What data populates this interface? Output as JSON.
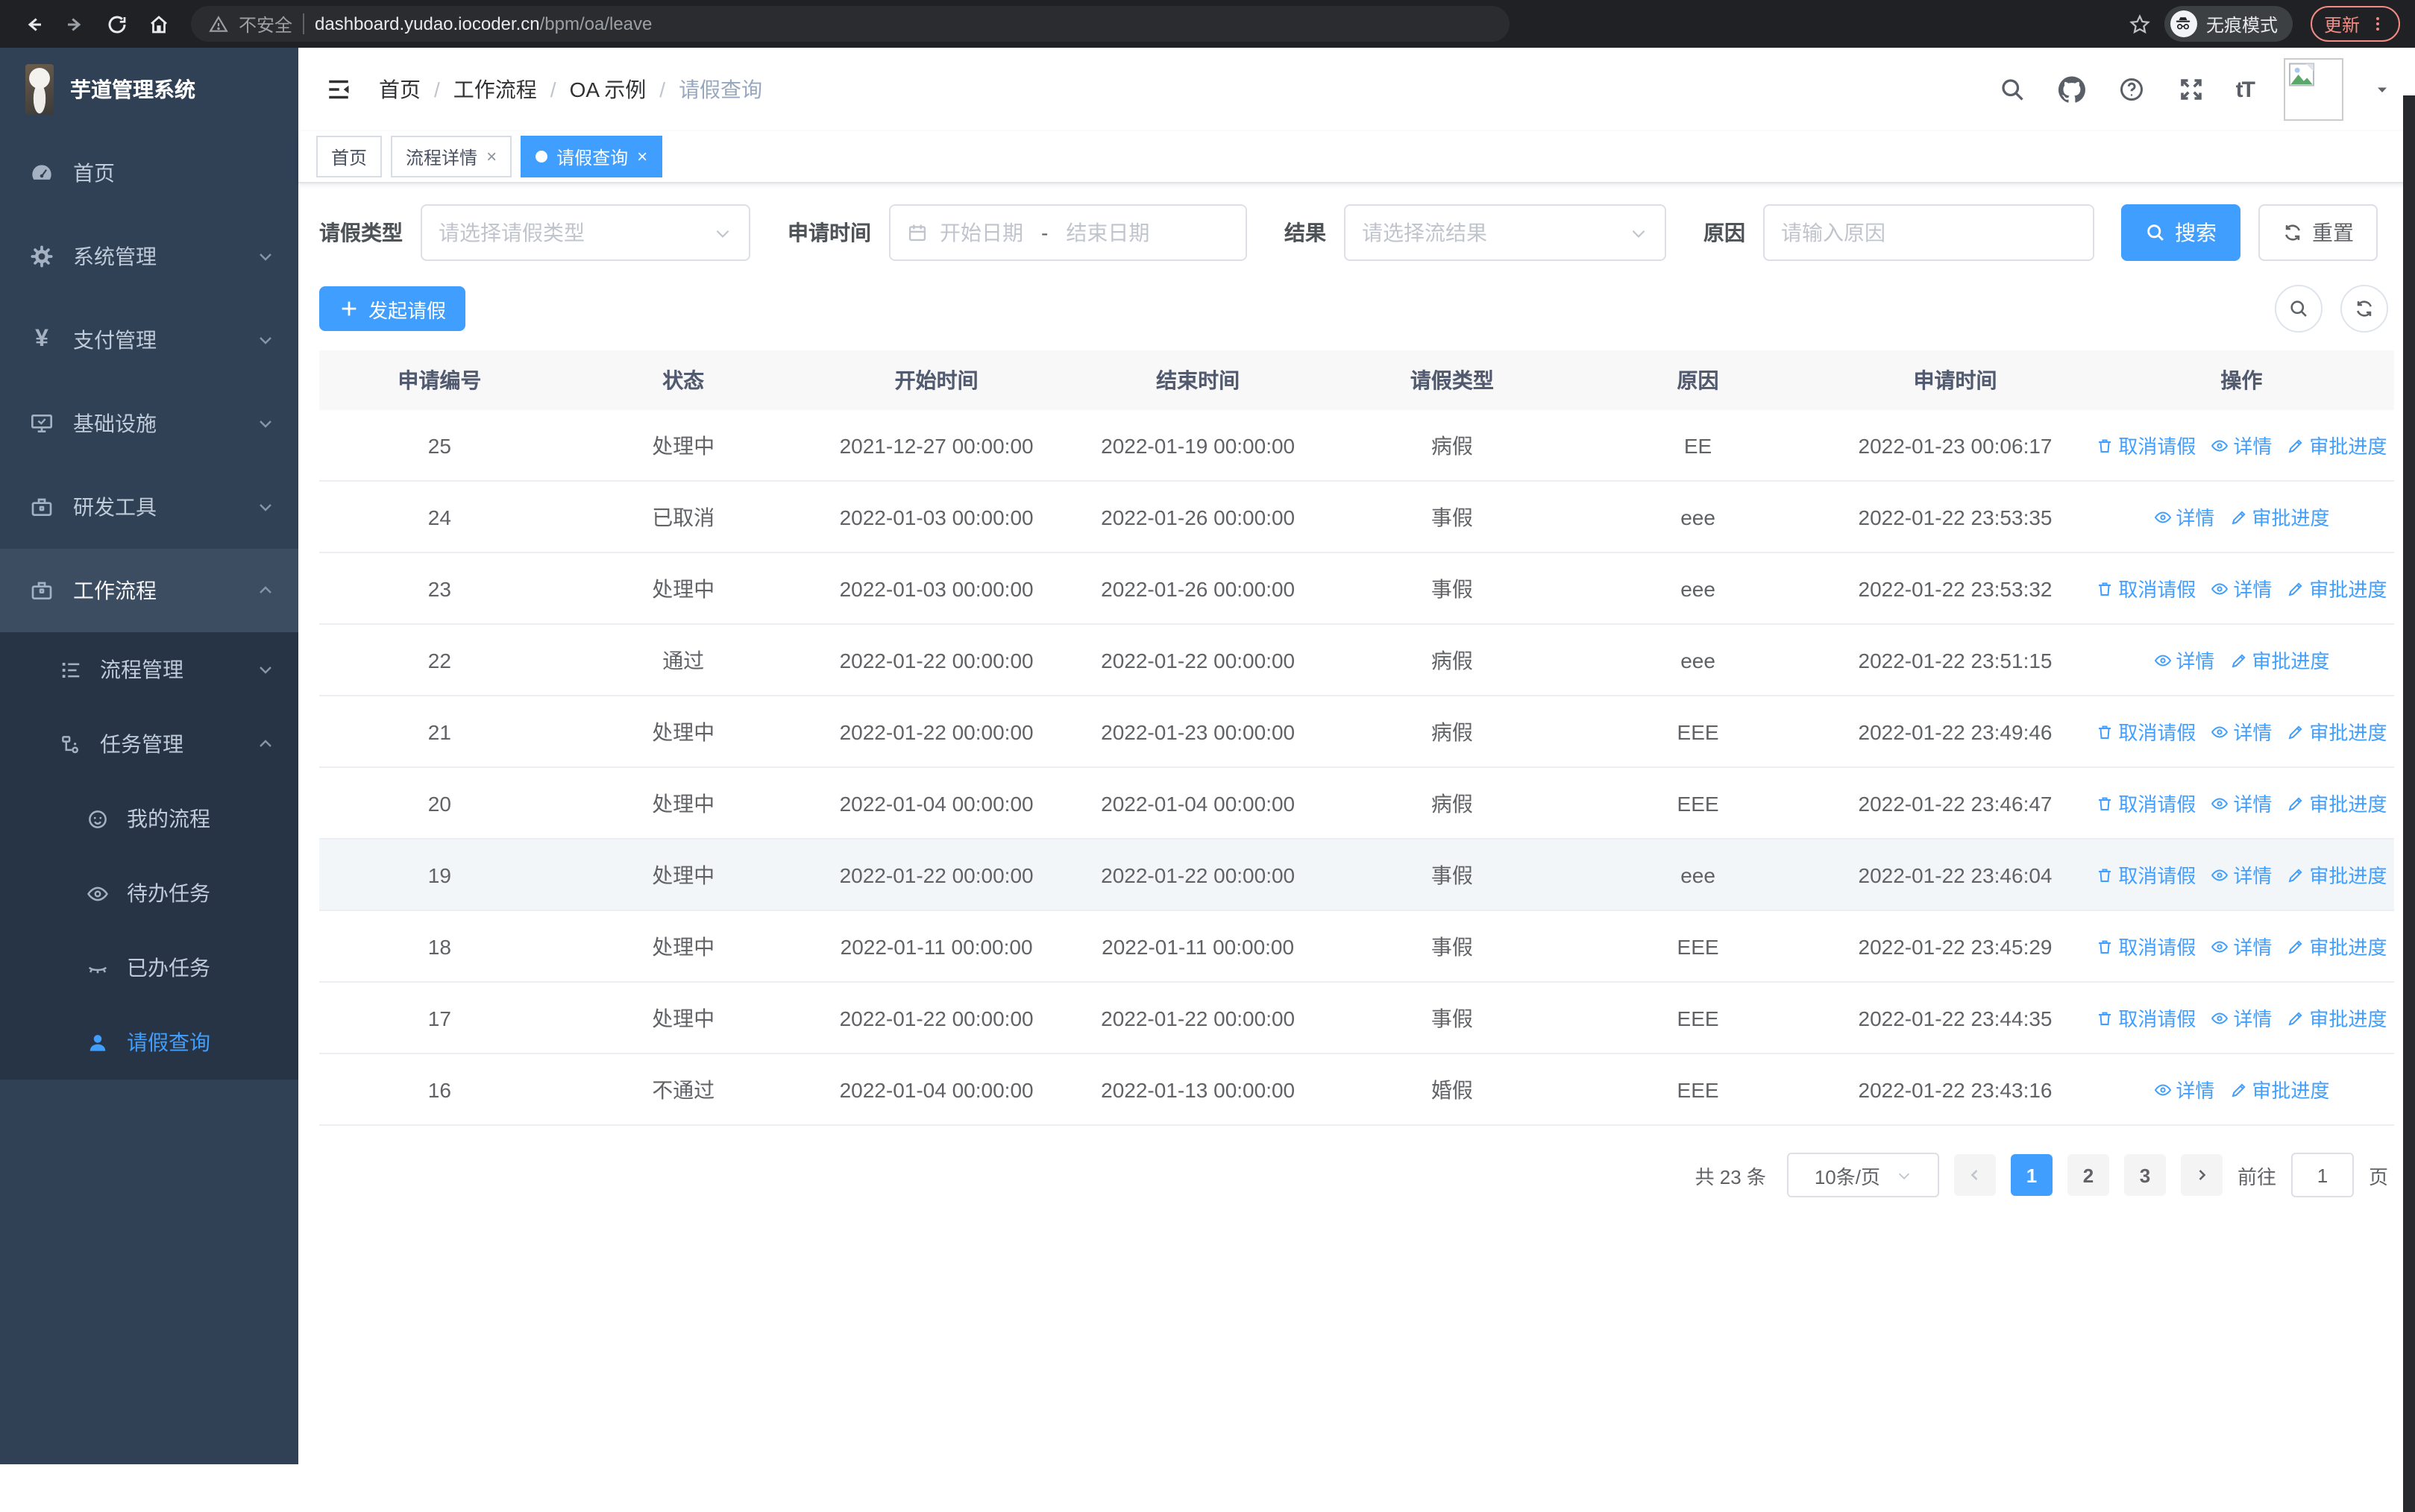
{
  "browser": {
    "security_label": "不安全",
    "url_host": "dashboard.yudao.iocoder.cn",
    "url_path": "/bpm/oa/leave",
    "incognito_label": "无痕模式",
    "update_label": "更新"
  },
  "sidebar": {
    "logo_title": "芋道管理系统",
    "items": [
      {
        "label": "首页"
      },
      {
        "label": "系统管理"
      },
      {
        "label": "支付管理"
      },
      {
        "label": "基础设施"
      },
      {
        "label": "研发工具"
      },
      {
        "label": "工作流程"
      }
    ],
    "submenu": [
      {
        "label": "流程管理"
      },
      {
        "label": "任务管理"
      }
    ],
    "task_children": [
      {
        "label": "我的流程"
      },
      {
        "label": "待办任务"
      },
      {
        "label": "已办任务"
      },
      {
        "label": "请假查询"
      }
    ]
  },
  "header": {
    "breadcrumb": [
      "首页",
      "工作流程",
      "OA 示例",
      "请假查询"
    ]
  },
  "tabs": [
    {
      "label": "首页"
    },
    {
      "label": "流程详情"
    },
    {
      "label": "请假查询"
    }
  ],
  "filters": {
    "type_label": "请假类型",
    "type_placeholder": "请选择请假类型",
    "time_label": "申请时间",
    "start_placeholder": "开始日期",
    "range_separator": "-",
    "end_placeholder": "结束日期",
    "result_label": "结果",
    "result_placeholder": "请选择流结果",
    "reason_label": "原因",
    "reason_placeholder": "请输入原因",
    "search_label": "搜索",
    "reset_label": "重置"
  },
  "toolbar": {
    "create_label": "发起请假"
  },
  "table": {
    "columns": [
      "申请编号",
      "状态",
      "开始时间",
      "结束时间",
      "请假类型",
      "原因",
      "申请时间",
      "操作"
    ],
    "action_labels": {
      "cancel": "取消请假",
      "detail": "详情",
      "progress": "审批进度"
    },
    "rows": [
      {
        "id": "25",
        "status": "处理中",
        "start": "2021-12-27 00:00:00",
        "end": "2022-01-19 00:00:00",
        "type": "病假",
        "reason": "EE",
        "applied": "2022-01-23 00:06:17",
        "actions": [
          "cancel",
          "detail",
          "progress"
        ],
        "highlight": false
      },
      {
        "id": "24",
        "status": "已取消",
        "start": "2022-01-03 00:00:00",
        "end": "2022-01-26 00:00:00",
        "type": "事假",
        "reason": "eee",
        "applied": "2022-01-22 23:53:35",
        "actions": [
          "detail",
          "progress"
        ],
        "highlight": false
      },
      {
        "id": "23",
        "status": "处理中",
        "start": "2022-01-03 00:00:00",
        "end": "2022-01-26 00:00:00",
        "type": "事假",
        "reason": "eee",
        "applied": "2022-01-22 23:53:32",
        "actions": [
          "cancel",
          "detail",
          "progress"
        ],
        "highlight": false
      },
      {
        "id": "22",
        "status": "通过",
        "start": "2022-01-22 00:00:00",
        "end": "2022-01-22 00:00:00",
        "type": "病假",
        "reason": "eee",
        "applied": "2022-01-22 23:51:15",
        "actions": [
          "detail",
          "progress"
        ],
        "highlight": false
      },
      {
        "id": "21",
        "status": "处理中",
        "start": "2022-01-22 00:00:00",
        "end": "2022-01-23 00:00:00",
        "type": "病假",
        "reason": "EEE",
        "applied": "2022-01-22 23:49:46",
        "actions": [
          "cancel",
          "detail",
          "progress"
        ],
        "highlight": false
      },
      {
        "id": "20",
        "status": "处理中",
        "start": "2022-01-04 00:00:00",
        "end": "2022-01-04 00:00:00",
        "type": "病假",
        "reason": "EEE",
        "applied": "2022-01-22 23:46:47",
        "actions": [
          "cancel",
          "detail",
          "progress"
        ],
        "highlight": false
      },
      {
        "id": "19",
        "status": "处理中",
        "start": "2022-01-22 00:00:00",
        "end": "2022-01-22 00:00:00",
        "type": "事假",
        "reason": "eee",
        "applied": "2022-01-22 23:46:04",
        "actions": [
          "cancel",
          "detail",
          "progress"
        ],
        "highlight": true
      },
      {
        "id": "18",
        "status": "处理中",
        "start": "2022-01-11 00:00:00",
        "end": "2022-01-11 00:00:00",
        "type": "事假",
        "reason": "EEE",
        "applied": "2022-01-22 23:45:29",
        "actions": [
          "cancel",
          "detail",
          "progress"
        ],
        "highlight": false
      },
      {
        "id": "17",
        "status": "处理中",
        "start": "2022-01-22 00:00:00",
        "end": "2022-01-22 00:00:00",
        "type": "事假",
        "reason": "EEE",
        "applied": "2022-01-22 23:44:35",
        "actions": [
          "cancel",
          "detail",
          "progress"
        ],
        "highlight": false
      },
      {
        "id": "16",
        "status": "不通过",
        "start": "2022-01-04 00:00:00",
        "end": "2022-01-13 00:00:00",
        "type": "婚假",
        "reason": "EEE",
        "applied": "2022-01-22 23:43:16",
        "actions": [
          "detail",
          "progress"
        ],
        "highlight": false
      }
    ]
  },
  "pagination": {
    "total_label": "共 23 条",
    "page_size": "10条/页",
    "pages": [
      "1",
      "2",
      "3"
    ],
    "current_page": "1",
    "goto_label": "前往",
    "goto_value": "1",
    "goto_suffix": "页"
  },
  "colors": {
    "primary": "#409eff",
    "sidebar_bg": "#304156",
    "submenu_bg": "#273445",
    "chrome_bg": "#202124",
    "update_accent": "#f28b82"
  }
}
